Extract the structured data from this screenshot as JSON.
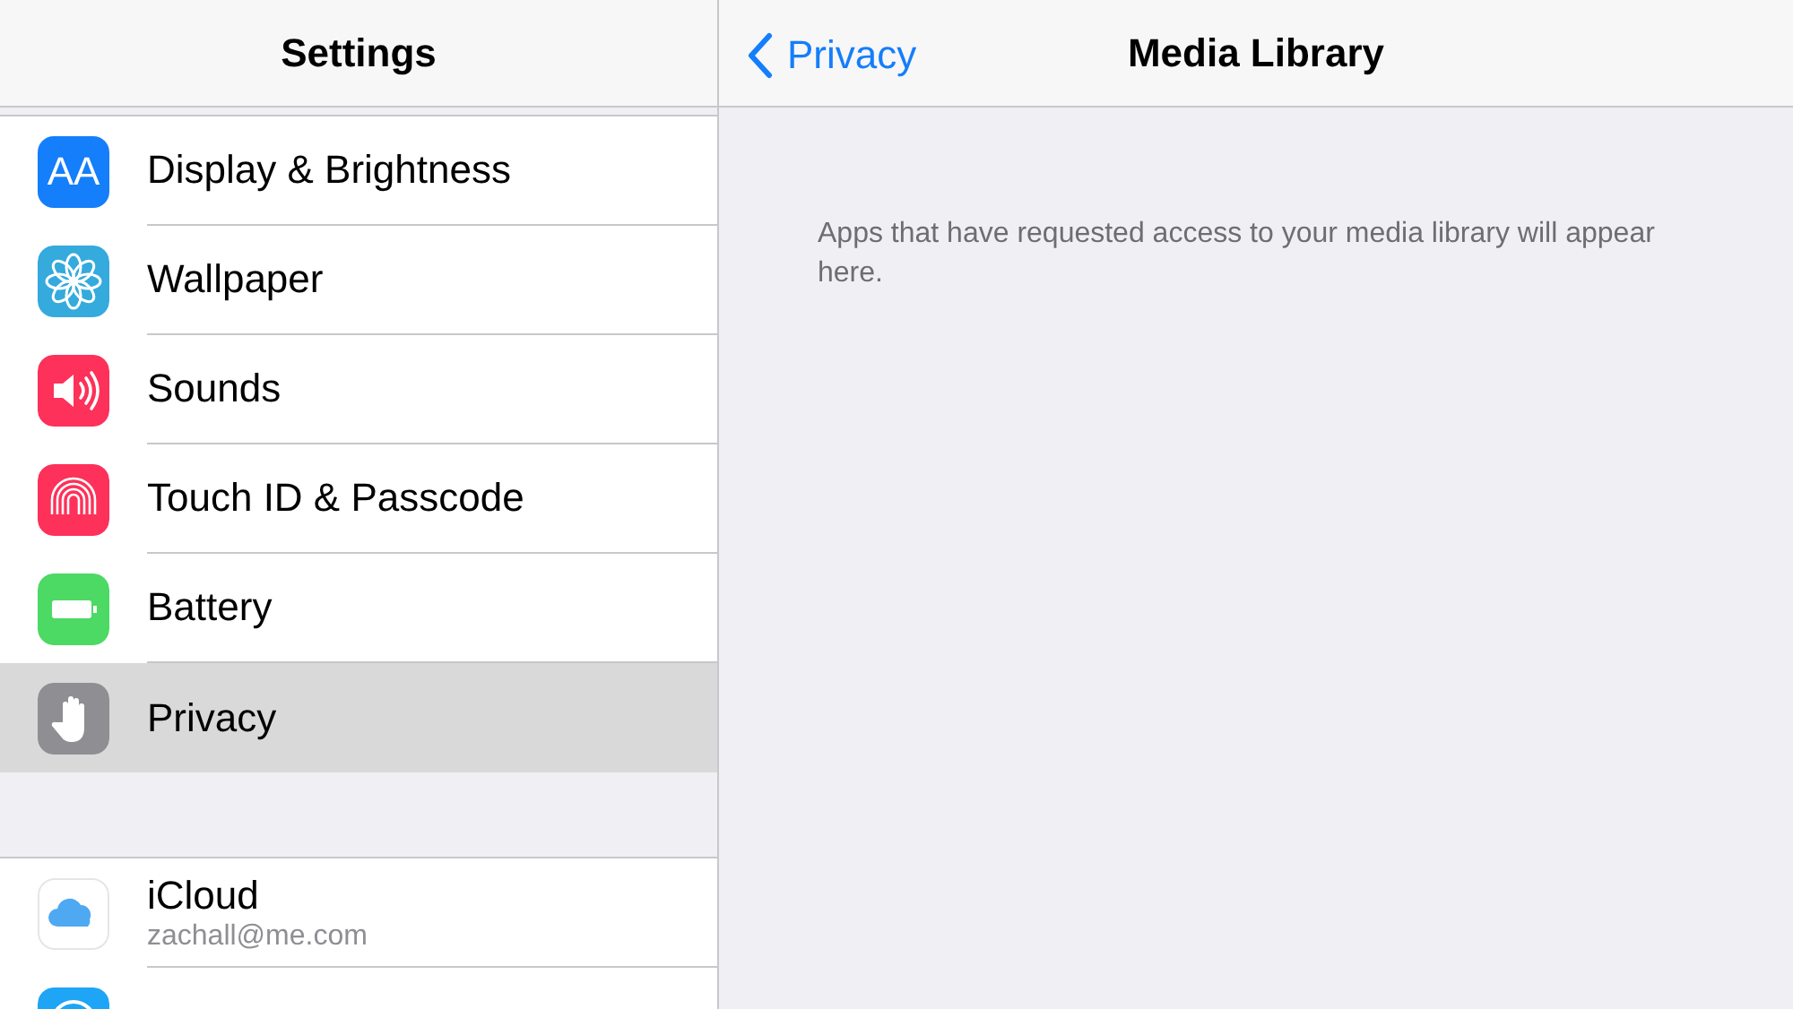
{
  "sidebar": {
    "title": "Settings",
    "groups": [
      {
        "items": [
          {
            "kind": "display",
            "label": "Display & Brightness",
            "icon_text": "AA",
            "selected": false
          },
          {
            "kind": "wallpaper",
            "label": "Wallpaper",
            "selected": false
          },
          {
            "kind": "sounds",
            "label": "Sounds",
            "selected": false
          },
          {
            "kind": "touchid",
            "label": "Touch ID & Passcode",
            "selected": false
          },
          {
            "kind": "battery",
            "label": "Battery",
            "selected": false
          },
          {
            "kind": "privacy",
            "label": "Privacy",
            "selected": true
          }
        ]
      },
      {
        "items": [
          {
            "kind": "icloud",
            "label": "iCloud",
            "subtitle": "zachall@me.com",
            "selected": false
          },
          {
            "kind": "appstore",
            "selected": false
          }
        ]
      }
    ]
  },
  "detail": {
    "back_label": "Privacy",
    "title": "Media Library",
    "message": "Apps that have requested access to your media library will appear here."
  }
}
